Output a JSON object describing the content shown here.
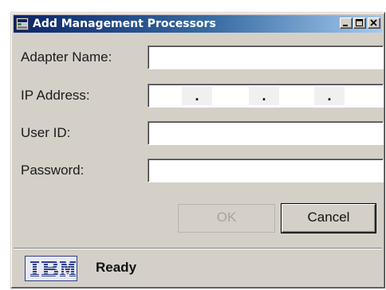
{
  "window": {
    "title": "Add Management Processors"
  },
  "form": {
    "adapter_name_label": "Adapter Name:",
    "adapter_name_value": "",
    "ip_address_label": "IP Address:",
    "ip_separator": ".",
    "user_id_label": "User ID:",
    "user_id_value": "",
    "password_label": "Password:",
    "password_value": ""
  },
  "buttons": {
    "ok_label": "OK",
    "cancel_label": "Cancel"
  },
  "status": {
    "logo_text": "IBM",
    "text": "Ready"
  },
  "colors": {
    "title_gradient_start": "#0a246a",
    "title_gradient_end": "#a6caf0",
    "window_bg": "#d4d0c8",
    "ibm_blue": "#2c3f8c"
  },
  "icons": {
    "app": "window-app-icon",
    "minimize": "minimize-icon",
    "maximize": "maximize-icon",
    "close": "close-icon"
  }
}
